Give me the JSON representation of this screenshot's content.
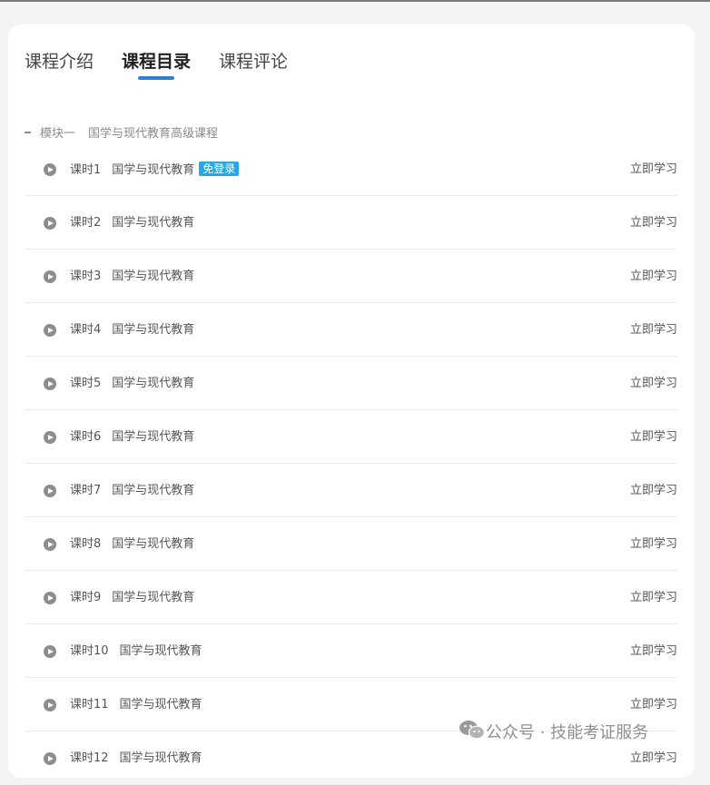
{
  "tabs": [
    {
      "label": "课程介绍",
      "active": false
    },
    {
      "label": "课程目录",
      "active": true
    },
    {
      "label": "课程评论",
      "active": false
    }
  ],
  "accent_color": "#2f7fd3",
  "badge_color": "#29a7e1",
  "module": {
    "name": "模块一",
    "title": "国学与现代教育高级课程"
  },
  "lessons": [
    {
      "num": "课时1",
      "title": "国学与现代教育",
      "badge": "免登录",
      "action": "立即学习"
    },
    {
      "num": "课时2",
      "title": "国学与现代教育",
      "action": "立即学习"
    },
    {
      "num": "课时3",
      "title": "国学与现代教育",
      "action": "立即学习"
    },
    {
      "num": "课时4",
      "title": "国学与现代教育",
      "action": "立即学习"
    },
    {
      "num": "课时5",
      "title": "国学与现代教育",
      "action": "立即学习"
    },
    {
      "num": "课时6",
      "title": "国学与现代教育",
      "action": "立即学习"
    },
    {
      "num": "课时7",
      "title": "国学与现代教育",
      "action": "立即学习"
    },
    {
      "num": "课时8",
      "title": "国学与现代教育",
      "action": "立即学习"
    },
    {
      "num": "课时9",
      "title": "国学与现代教育",
      "action": "立即学习"
    },
    {
      "num": "课时10",
      "title": "国学与现代教育",
      "action": "立即学习"
    },
    {
      "num": "课时11",
      "title": "国学与现代教育",
      "action": "立即学习"
    },
    {
      "num": "课时12",
      "title": "国学与现代教育",
      "action": "立即学习"
    }
  ],
  "watermark": {
    "icon": "wechat-icon",
    "text": "公众号 · 技能考证服务"
  }
}
